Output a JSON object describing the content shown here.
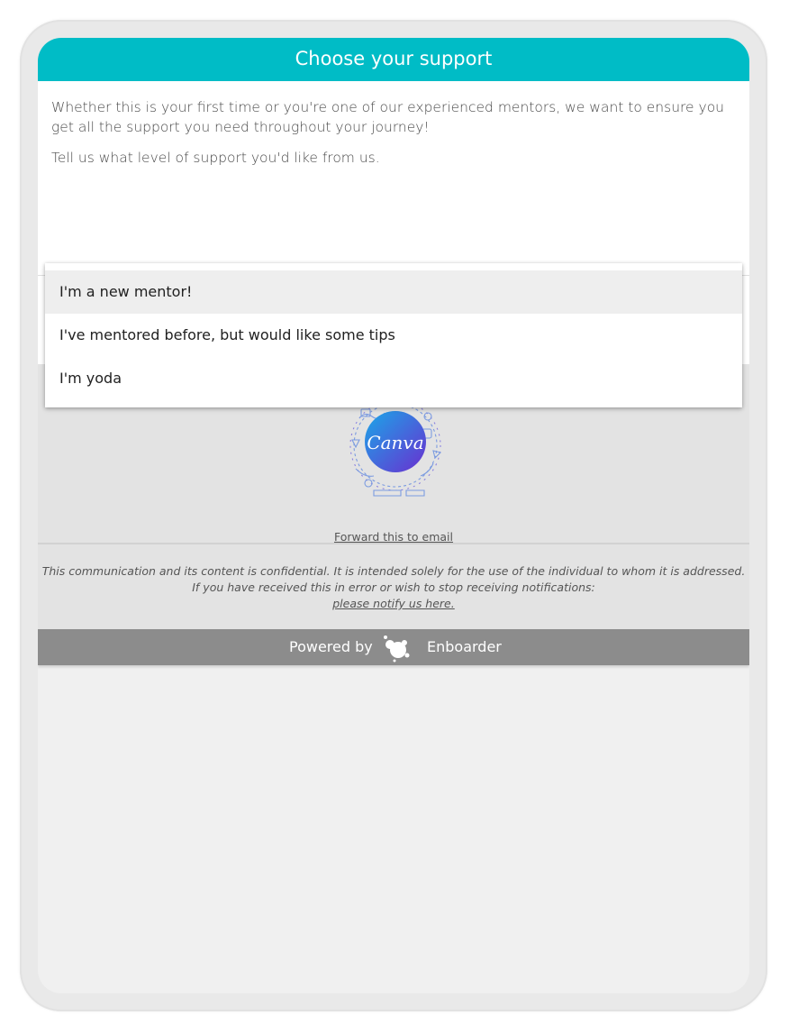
{
  "header": {
    "title": "Choose your support"
  },
  "intro": {
    "paragraph1": "Whether this is your first time or you're one of our experienced mentors, we want to ensure you get all the support you need throughout your journey!",
    "paragraph2": "Tell us what level of support you'd like from us."
  },
  "support_select": {
    "options": [
      {
        "label": "I'm a new mentor!",
        "highlighted": true
      },
      {
        "label": "I've mentored before, but would like some tips",
        "highlighted": false
      },
      {
        "label": "I'm yoda",
        "highlighted": false
      }
    ]
  },
  "logo": {
    "icon": "canva-logo",
    "text": "Canva",
    "colors": {
      "start": "#1aa7e8",
      "end": "#6a2fd0"
    }
  },
  "footer": {
    "forward_link": "Forward this to email",
    "disclaimer_line1": "This communication and its content is confidential. It is intended solely for the use of the individual to whom it is addressed.",
    "disclaimer_line2": "If you have received this in error or wish to stop receiving notifications:",
    "notify_link": "please notify us here."
  },
  "powered_by": {
    "label": "Powered by",
    "brand": "Enboarder",
    "icon": "enboarder-logo-icon"
  },
  "colors": {
    "header_bg": "#00bcc6",
    "footer_bar_bg": "#8c8c8c",
    "footer_bg": "#e3e3e3"
  }
}
